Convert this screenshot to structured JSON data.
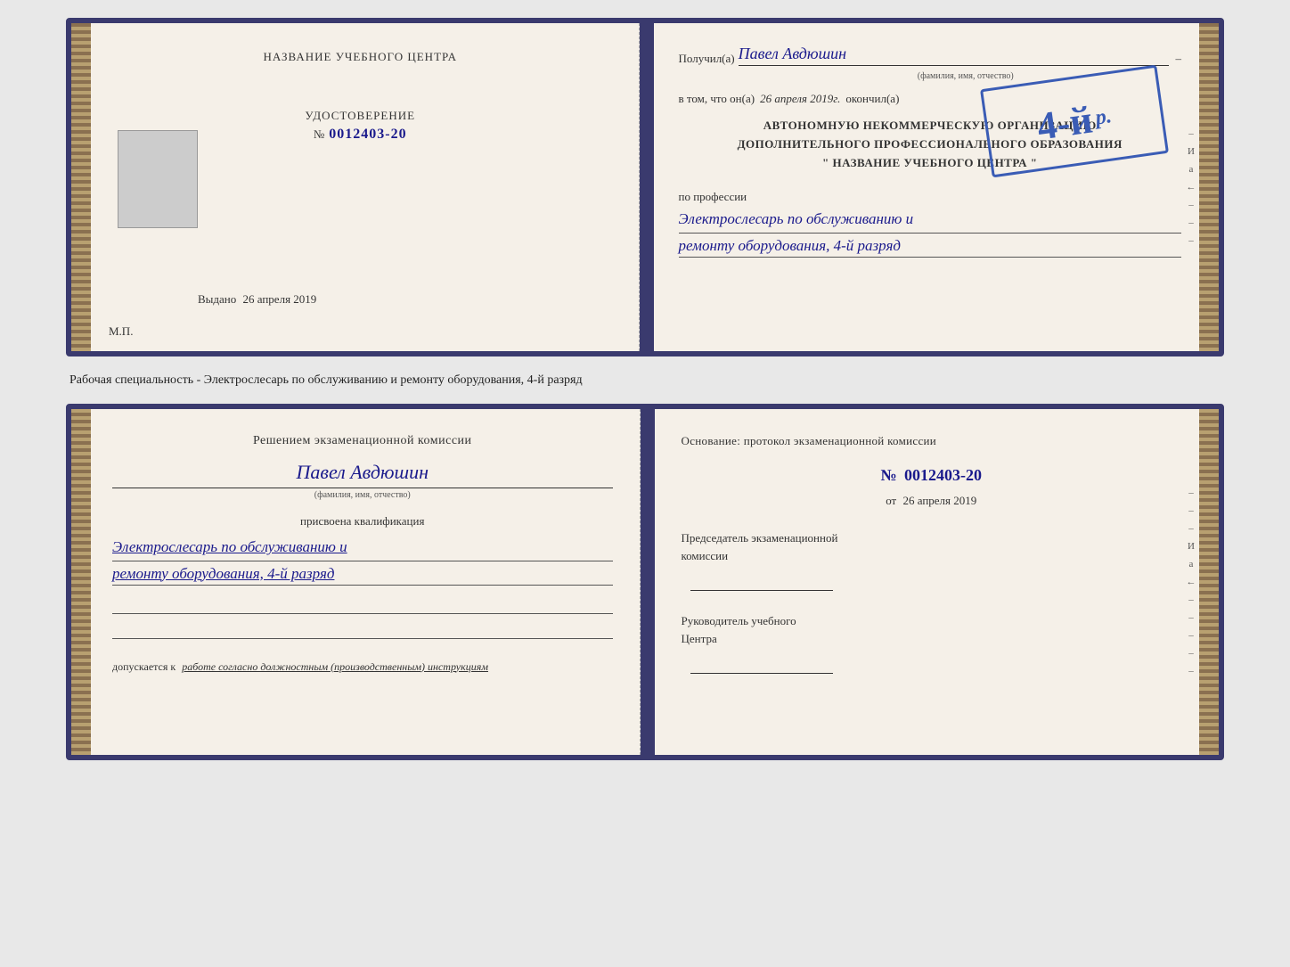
{
  "top_spread": {
    "left_page": {
      "title": "НАЗВАНИЕ УЧЕБНОГО ЦЕНТРА",
      "cert_label": "УДОСТОВЕРЕНИЕ",
      "cert_number_prefix": "№",
      "cert_number": "0012403-20",
      "issued_label": "Выдано",
      "issued_date": "26 апреля 2019",
      "mp_label": "М.П."
    },
    "right_page": {
      "recipient_label": "Получил(а)",
      "recipient_name": "Павел Авдюшин",
      "fio_hint": "(фамилия, имя, отчество)",
      "vtom_label": "в том, что он(а)",
      "vtom_date": "26 апреля 2019г.",
      "okonchill_label": "окончил(а)",
      "org_line1": "АВТОНОМНУЮ НЕКОММЕРЧЕСКУЮ ОРГАНИЗАЦИЮ",
      "org_line2": "ДОПОЛНИТЕЛЬНОГО ПРОФЕССИОНАЛЬНОГО ОБРАЗОВАНИЯ",
      "org_line3": "\" НАЗВАНИЕ УЧЕБНОГО ЦЕНТРА \"",
      "profession_label": "по профессии",
      "profession_line1": "Электрослесарь по обслуживанию и",
      "profession_line2": "ремонту оборудования, 4-й разряд",
      "stamp_text": "4-й"
    },
    "side_chars": [
      "И",
      "а",
      "←",
      "–",
      "–",
      "–",
      "–"
    ]
  },
  "caption": {
    "text": "Рабочая специальность - Электрослесарь по обслуживанию и ремонту оборудования, 4-й разряд"
  },
  "bottom_spread": {
    "left_page": {
      "decision_title": "Решением экзаменационной комиссии",
      "person_name": "Павел Авдюшин",
      "fio_hint": "(фамилия, имя, отчество)",
      "assigned_label": "присвоена квалификация",
      "qualification_line1": "Электрослесарь по обслуживанию и",
      "qualification_line2": "ремонту оборудования, 4-й разряд",
      "dopusk_label": "допускается к",
      "dopusk_text": "работе согласно должностным (производственным) инструкциям"
    },
    "right_page": {
      "osnov_label": "Основание: протокол экзаменационной комиссии",
      "protocol_prefix": "№",
      "protocol_number": "0012403-20",
      "ot_prefix": "от",
      "ot_date": "26 апреля 2019",
      "chairman_title_line1": "Председатель экзаменационной",
      "chairman_title_line2": "комиссии",
      "director_title_line1": "Руководитель учебного",
      "director_title_line2": "Центра"
    },
    "side_chars": [
      "–",
      "–",
      "–",
      "И",
      "а",
      "←",
      "–",
      "–",
      "–",
      "–",
      "–"
    ]
  }
}
